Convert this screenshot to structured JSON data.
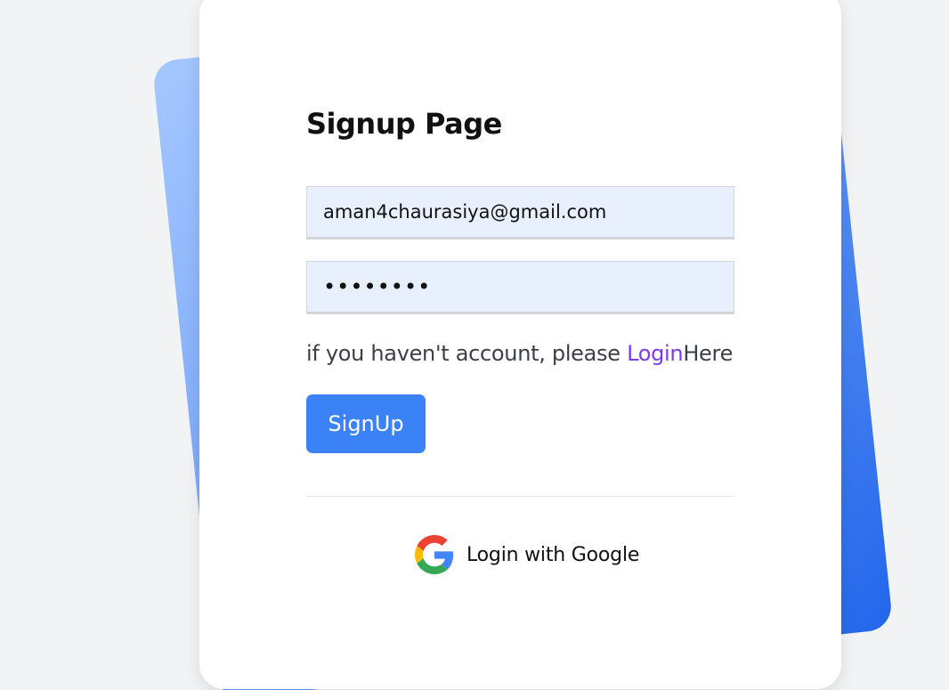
{
  "page": {
    "title": "Signup Page"
  },
  "form": {
    "email_value": "aman4chaurasiya@gmail.com",
    "password_value": "••••••••"
  },
  "hint": {
    "prefix": "if you haven't account, please ",
    "link_label": "Login",
    "suffix": "Here"
  },
  "buttons": {
    "signup_label": "SignUp"
  },
  "oauth": {
    "google_label": "Login with Google",
    "icon": "google-icon"
  },
  "colors": {
    "background": "#f2f3f5",
    "card": "#ffffff",
    "accent": "#3b82f6",
    "link": "#7c3aed",
    "input_bg": "#e8f0fe",
    "back_card_gradient_start": "#a6c8ff",
    "back_card_gradient_end": "#2366ec"
  }
}
